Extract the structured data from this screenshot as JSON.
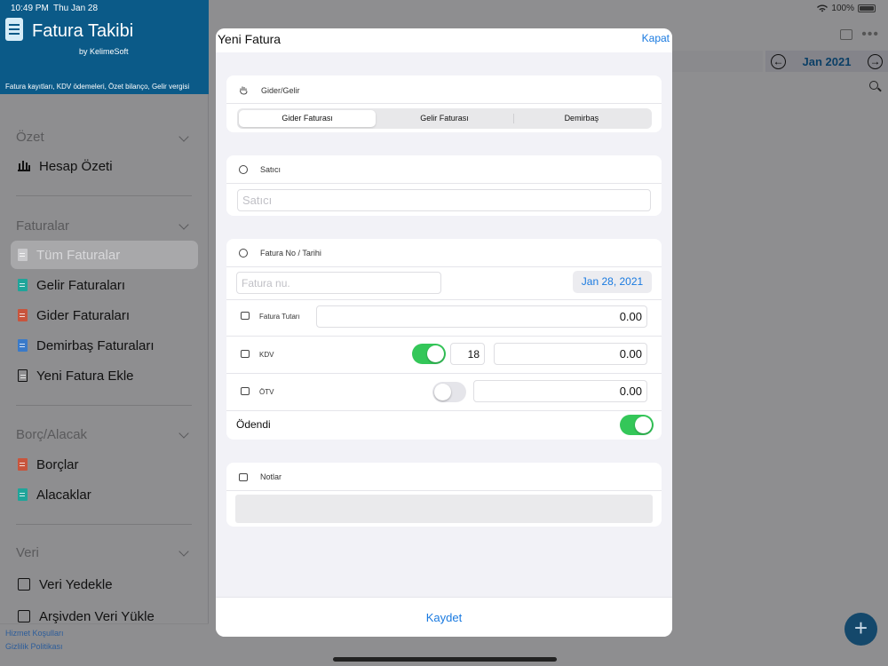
{
  "status": {
    "time": "10:49 PM",
    "date": "Thu Jan 28",
    "battery": "100%"
  },
  "app": {
    "title": "Fatura Takibi",
    "by": "by KelimeSoft",
    "tagline": "Fatura kayıtları, KDV ödemeleri, Özet bilanço, Gelir vergisi"
  },
  "sidebar": {
    "sections": [
      {
        "title": "Özet",
        "items": [
          {
            "label": "Hesap Özeti",
            "icon": "bar-chart-icon"
          }
        ]
      },
      {
        "title": "Faturalar",
        "items": [
          {
            "label": "Tüm Faturalar",
            "icon": "document-icon",
            "color": "#c9c9cc",
            "selected": true
          },
          {
            "label": "Gelir Faturaları",
            "icon": "document-icon",
            "color": "#1fa59a"
          },
          {
            "label": "Gider Faturaları",
            "icon": "document-icon",
            "color": "#c8553d"
          },
          {
            "label": "Demirbaş Faturaları",
            "icon": "document-icon",
            "color": "#3a7ac9"
          },
          {
            "label": "Yeni Fatura Ekle",
            "icon": "document-add-icon"
          }
        ]
      },
      {
        "title": "Borç/Alacak",
        "items": [
          {
            "label": "Borçlar",
            "icon": "document-icon",
            "color": "#c8553d"
          },
          {
            "label": "Alacaklar",
            "icon": "document-icon",
            "color": "#1fa59a"
          }
        ]
      },
      {
        "title": "Veri",
        "items": [
          {
            "label": "Veri Yedekle",
            "icon": "backup-icon"
          },
          {
            "label": "Arşivden Veri Yükle",
            "icon": "restore-icon"
          }
        ]
      }
    ],
    "footer": {
      "terms": "Hizmet Koşulları",
      "privacy": "Gizlilik Politikası"
    }
  },
  "background": {
    "month": "Jan 2021"
  },
  "modal": {
    "title": "Yeni Fatura",
    "close": "Kapat",
    "type_section": {
      "label": "Gider/Gelir",
      "options": [
        "Gider Faturası",
        "Gelir Faturası",
        "Demirbaş"
      ],
      "selected": 0
    },
    "seller_section": {
      "label": "Satıcı",
      "placeholder": "Satıcı"
    },
    "invoice_section": {
      "label": "Fatura No / Tarihi",
      "number_placeholder": "Fatura nu.",
      "date": "Jan 28, 2021",
      "amount_label": "Fatura Tutarı",
      "amount": "0.00",
      "kdv_label": "KDV",
      "kdv_enabled": true,
      "kdv_rate": "18",
      "kdv_amount": "0.00",
      "otv_label": "ÖTV",
      "otv_enabled": false,
      "otv_amount": "0.00",
      "paid_label": "Ödendi",
      "paid": true
    },
    "notes_section": {
      "label": "Notlar"
    },
    "save": "Kaydet"
  },
  "colors": {
    "accent": "#1a7ae0",
    "header": "#0b5a88",
    "toggle_on": "#34c759"
  }
}
